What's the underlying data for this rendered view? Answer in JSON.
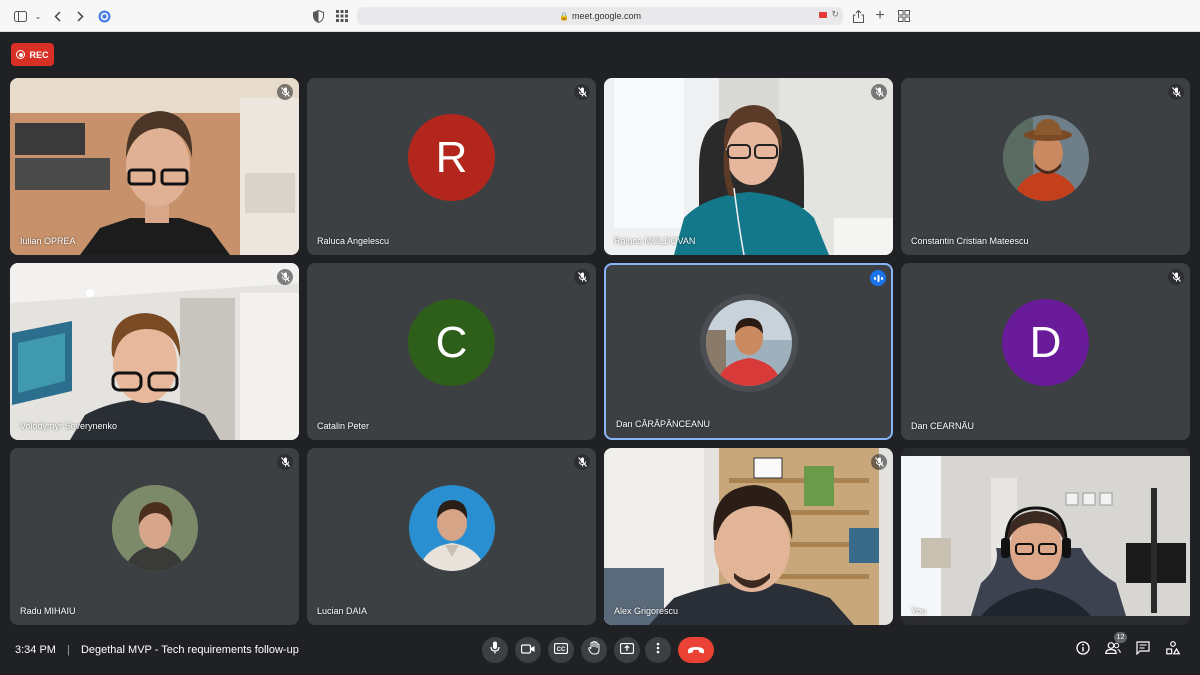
{
  "browser": {
    "url": "meet.google.com"
  },
  "recording": {
    "label": "REC"
  },
  "participants": [
    {
      "name": "Iulian OPREA",
      "muted": true,
      "type": "video"
    },
    {
      "name": "Raluca Angelescu",
      "muted": true,
      "type": "letter",
      "letter": "R",
      "color": "#b3261e"
    },
    {
      "name": "Raluca MOLDOVAN",
      "muted": true,
      "type": "video"
    },
    {
      "name": "Constantin Cristian Mateescu",
      "muted": true,
      "type": "avatar"
    },
    {
      "name": "Volodymyr Severynenko",
      "muted": true,
      "type": "video"
    },
    {
      "name": "Catalin Peter",
      "muted": true,
      "type": "letter",
      "letter": "C",
      "color": "#2e5f1a"
    },
    {
      "name": "Dan CĂRĂPÂNCEANU",
      "muted": false,
      "speaking": true,
      "type": "avatar"
    },
    {
      "name": "Dan CEARNĂU",
      "muted": true,
      "type": "letter",
      "letter": "D",
      "color": "#6a1b9a"
    },
    {
      "name": "Radu MIHAIU",
      "muted": true,
      "type": "avatar"
    },
    {
      "name": "Lucian DAIA",
      "muted": true,
      "type": "avatar"
    },
    {
      "name": "Alex Grigorescu",
      "muted": true,
      "type": "video"
    },
    {
      "name": "You",
      "muted": false,
      "type": "video"
    }
  ],
  "meeting": {
    "time": "3:34 PM",
    "separator": "|",
    "title": "Degethal MVP - Tech requirements follow-up"
  },
  "controls": [
    "mic-icon",
    "camera-icon",
    "captions-icon",
    "raise-hand-icon",
    "present-icon",
    "more-icon",
    "end-call-icon"
  ],
  "right_controls": {
    "people_count": "12"
  },
  "colors": {
    "background": "#202124",
    "tile": "#3c4043",
    "accent": "#1a73e8",
    "end_call": "#ea4335"
  }
}
